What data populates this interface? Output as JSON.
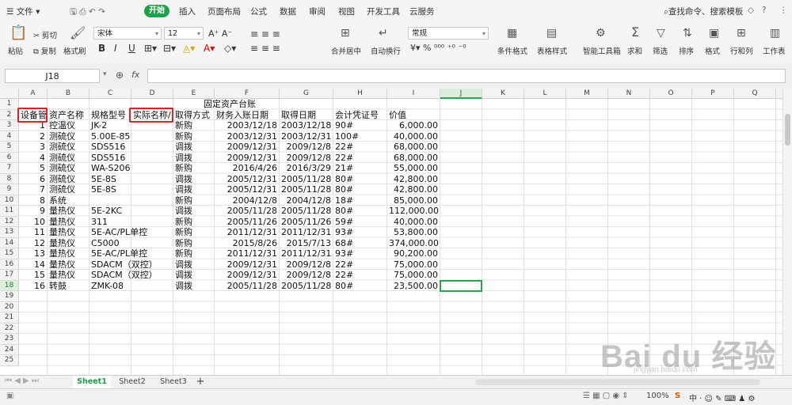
{
  "menubar": {
    "file": "文件",
    "start": "开始",
    "items": [
      "插入",
      "页面布局",
      "公式",
      "数据",
      "审阅",
      "视图",
      "开发工具",
      "云服务"
    ],
    "search": "查找命令、搜索模板"
  },
  "ribbon": {
    "paste": "粘贴",
    "cut": "剪切",
    "copy": "复制",
    "format_painter": "格式刷",
    "font_name": "宋体",
    "font_size": "12",
    "merge_center": "合并居中",
    "auto_wrap": "自动换行",
    "number_format": "常规",
    "conditional_format": "条件格式",
    "table_style": "表格样式",
    "smart_toolbox": "智能工具箱",
    "sum": "求和",
    "filter": "筛选",
    "sort": "排序",
    "format": "格式",
    "row_col": "行和列",
    "worksheet": "工作表"
  },
  "formula_bar": {
    "name_box": "J18",
    "fx": "fx"
  },
  "columns": [
    "A",
    "B",
    "C",
    "D",
    "E",
    "F",
    "G",
    "H",
    "I",
    "J",
    "K",
    "L",
    "M",
    "N",
    "O",
    "P",
    "Q",
    "R"
  ],
  "rows": [
    "1",
    "2",
    "3",
    "4",
    "5",
    "6",
    "7",
    "8",
    "9",
    "10",
    "11",
    "12",
    "13",
    "14",
    "15",
    "16",
    "17",
    "18",
    "19",
    "20",
    "21",
    "22",
    "23",
    "24",
    "25"
  ],
  "sheet": {
    "title": "固定资产台账",
    "headers": [
      "设备管",
      "资产名称",
      "规格型号",
      "实际名称/",
      "取得方式",
      "财务入账日期",
      "取得日期",
      "会计凭证号",
      "价值"
    ],
    "data": [
      [
        "1",
        "控温仪",
        "JK-2",
        "",
        "新购",
        "2003/12/18",
        "2003/12/18",
        "90#",
        "6,000.00"
      ],
      [
        "2",
        "测硫仪",
        "5.00E-85",
        "",
        "新购",
        "2003/12/31",
        "2003/12/31",
        "100#",
        "40,000.00"
      ],
      [
        "3",
        "测硫仪",
        "SDS516",
        "",
        "调拨",
        "2009/12/31",
        "2009/12/8",
        "22#",
        "68,000.00"
      ],
      [
        "4",
        "测硫仪",
        "SDS516",
        "",
        "调拨",
        "2009/12/31",
        "2009/12/8",
        "22#",
        "68,000.00"
      ],
      [
        "5",
        "测硫仪",
        "WA-S206",
        "",
        "新购",
        "2016/4/26",
        "2016/3/29",
        "21#",
        "55,000.00"
      ],
      [
        "6",
        "测硫仪",
        "5E-8S",
        "",
        "调拨",
        "2005/12/31",
        "2005/11/28",
        "80#",
        "42,800.00"
      ],
      [
        "7",
        "测硫仪",
        "5E-8S",
        "",
        "调拨",
        "2005/12/31",
        "2005/11/28",
        "80#",
        "42,800.00"
      ],
      [
        "8",
        "系统",
        "",
        "",
        "新购",
        "2004/12/8",
        "2004/12/8",
        "18#",
        "85,000.00"
      ],
      [
        "9",
        "量热仪",
        "5E-2KC",
        "",
        "调拨",
        "2005/11/28",
        "2005/11/28",
        "80#",
        "112,000.00"
      ],
      [
        "10",
        "量热仪",
        "311",
        "",
        "新购",
        "2005/11/26",
        "2005/11/26",
        "59#",
        "40,000.00"
      ],
      [
        "11",
        "量热仪",
        "5E-AC/PL单控",
        "",
        "新购",
        "2011/12/31",
        "2011/12/31",
        "93#",
        "53,800.00"
      ],
      [
        "12",
        "量热仪",
        "C5000",
        "",
        "新购",
        "2015/8/26",
        "2015/7/13",
        "68#",
        "374,000.00"
      ],
      [
        "13",
        "量热仪",
        "5E-AC/PL单控",
        "",
        "新购",
        "2011/12/31",
        "2011/12/31",
        "93#",
        "90,200.00"
      ],
      [
        "14",
        "量热仪",
        "SDACM（双控）",
        "",
        "调拨",
        "2009/12/31",
        "2009/12/8",
        "22#",
        "75,000.00"
      ],
      [
        "15",
        "量热仪",
        "SDACM（双控）",
        "",
        "调拨",
        "2009/12/31",
        "2009/12/8",
        "22#",
        "75,000.00"
      ],
      [
        "16",
        "转鼓",
        "ZMK-08",
        "",
        "调拨",
        "2005/11/28",
        "2005/11/28",
        "80#",
        "23,500.00"
      ]
    ]
  },
  "tabs": [
    "Sheet1",
    "Sheet2",
    "Sheet3"
  ],
  "status": {
    "zoom": "100%"
  },
  "watermark": {
    "brand": "Bai du 经验",
    "url": "jingyan.baidu.com"
  }
}
